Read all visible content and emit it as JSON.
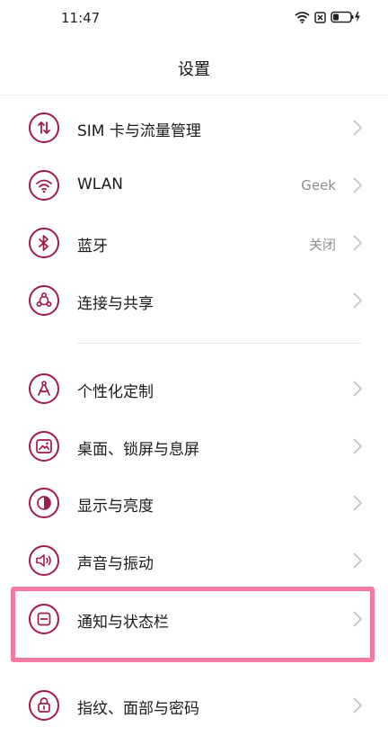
{
  "status_bar": {
    "time": "11:47",
    "icons": [
      "wifi-icon",
      "sim-blocked-icon",
      "battery-charging-icon"
    ]
  },
  "header": {
    "title": "设置"
  },
  "settings": [
    {
      "id": "sim",
      "label": "SIM 卡与流量管理",
      "value": "",
      "icon": "sim-data-icon"
    },
    {
      "id": "wlan",
      "label": "WLAN",
      "value": "Geek",
      "icon": "wifi-icon"
    },
    {
      "id": "bluetooth",
      "label": "蓝牙",
      "value": "关闭",
      "icon": "bluetooth-icon"
    },
    {
      "id": "connection",
      "label": "连接与共享",
      "value": "",
      "icon": "share-icon"
    },
    {
      "id": "personal",
      "label": "个性化定制",
      "value": "",
      "icon": "compass-icon"
    },
    {
      "id": "wallpaper",
      "label": "桌面、锁屏与息屏",
      "value": "",
      "icon": "wallpaper-icon"
    },
    {
      "id": "display",
      "label": "显示与亮度",
      "value": "",
      "icon": "brightness-icon"
    },
    {
      "id": "sound",
      "label": "声音与振动",
      "value": "",
      "icon": "speaker-icon"
    },
    {
      "id": "notify",
      "label": "通知与状态栏",
      "value": "",
      "icon": "notification-icon"
    },
    {
      "id": "security",
      "label": "指纹、面部与密码",
      "value": "",
      "icon": "lock-icon"
    }
  ],
  "colors": {
    "accent": "#a01a4b",
    "highlight": "#f47aa2",
    "secondary_text": "#8c8c8c"
  }
}
